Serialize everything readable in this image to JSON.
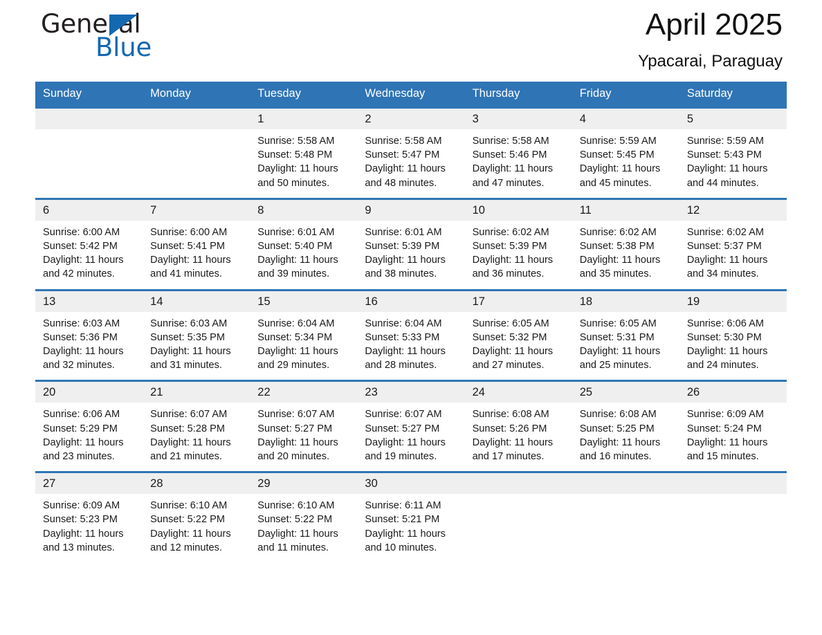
{
  "brand": {
    "word_one": "General",
    "word_two": "Blue",
    "triangle_color": "#1368b0"
  },
  "header": {
    "title": "April 2025",
    "subtitle": "Ypacarai, Paraguay",
    "accent_color": "#2f74b5",
    "daynum_band_color": "#efefef"
  },
  "calendar": {
    "weekdays": [
      "Sunday",
      "Monday",
      "Tuesday",
      "Wednesday",
      "Thursday",
      "Friday",
      "Saturday"
    ],
    "weeks": [
      [
        {
          "day": "",
          "empty": true
        },
        {
          "day": "",
          "empty": true
        },
        {
          "day": "1",
          "sunrise": "Sunrise: 5:58 AM",
          "sunset": "Sunset: 5:48 PM",
          "daylight_1": "Daylight: 11 hours",
          "daylight_2": "and 50 minutes."
        },
        {
          "day": "2",
          "sunrise": "Sunrise: 5:58 AM",
          "sunset": "Sunset: 5:47 PM",
          "daylight_1": "Daylight: 11 hours",
          "daylight_2": "and 48 minutes."
        },
        {
          "day": "3",
          "sunrise": "Sunrise: 5:58 AM",
          "sunset": "Sunset: 5:46 PM",
          "daylight_1": "Daylight: 11 hours",
          "daylight_2": "and 47 minutes."
        },
        {
          "day": "4",
          "sunrise": "Sunrise: 5:59 AM",
          "sunset": "Sunset: 5:45 PM",
          "daylight_1": "Daylight: 11 hours",
          "daylight_2": "and 45 minutes."
        },
        {
          "day": "5",
          "sunrise": "Sunrise: 5:59 AM",
          "sunset": "Sunset: 5:43 PM",
          "daylight_1": "Daylight: 11 hours",
          "daylight_2": "and 44 minutes."
        }
      ],
      [
        {
          "day": "6",
          "sunrise": "Sunrise: 6:00 AM",
          "sunset": "Sunset: 5:42 PM",
          "daylight_1": "Daylight: 11 hours",
          "daylight_2": "and 42 minutes."
        },
        {
          "day": "7",
          "sunrise": "Sunrise: 6:00 AM",
          "sunset": "Sunset: 5:41 PM",
          "daylight_1": "Daylight: 11 hours",
          "daylight_2": "and 41 minutes."
        },
        {
          "day": "8",
          "sunrise": "Sunrise: 6:01 AM",
          "sunset": "Sunset: 5:40 PM",
          "daylight_1": "Daylight: 11 hours",
          "daylight_2": "and 39 minutes."
        },
        {
          "day": "9",
          "sunrise": "Sunrise: 6:01 AM",
          "sunset": "Sunset: 5:39 PM",
          "daylight_1": "Daylight: 11 hours",
          "daylight_2": "and 38 minutes."
        },
        {
          "day": "10",
          "sunrise": "Sunrise: 6:02 AM",
          "sunset": "Sunset: 5:39 PM",
          "daylight_1": "Daylight: 11 hours",
          "daylight_2": "and 36 minutes."
        },
        {
          "day": "11",
          "sunrise": "Sunrise: 6:02 AM",
          "sunset": "Sunset: 5:38 PM",
          "daylight_1": "Daylight: 11 hours",
          "daylight_2": "and 35 minutes."
        },
        {
          "day": "12",
          "sunrise": "Sunrise: 6:02 AM",
          "sunset": "Sunset: 5:37 PM",
          "daylight_1": "Daylight: 11 hours",
          "daylight_2": "and 34 minutes."
        }
      ],
      [
        {
          "day": "13",
          "sunrise": "Sunrise: 6:03 AM",
          "sunset": "Sunset: 5:36 PM",
          "daylight_1": "Daylight: 11 hours",
          "daylight_2": "and 32 minutes."
        },
        {
          "day": "14",
          "sunrise": "Sunrise: 6:03 AM",
          "sunset": "Sunset: 5:35 PM",
          "daylight_1": "Daylight: 11 hours",
          "daylight_2": "and 31 minutes."
        },
        {
          "day": "15",
          "sunrise": "Sunrise: 6:04 AM",
          "sunset": "Sunset: 5:34 PM",
          "daylight_1": "Daylight: 11 hours",
          "daylight_2": "and 29 minutes."
        },
        {
          "day": "16",
          "sunrise": "Sunrise: 6:04 AM",
          "sunset": "Sunset: 5:33 PM",
          "daylight_1": "Daylight: 11 hours",
          "daylight_2": "and 28 minutes."
        },
        {
          "day": "17",
          "sunrise": "Sunrise: 6:05 AM",
          "sunset": "Sunset: 5:32 PM",
          "daylight_1": "Daylight: 11 hours",
          "daylight_2": "and 27 minutes."
        },
        {
          "day": "18",
          "sunrise": "Sunrise: 6:05 AM",
          "sunset": "Sunset: 5:31 PM",
          "daylight_1": "Daylight: 11 hours",
          "daylight_2": "and 25 minutes."
        },
        {
          "day": "19",
          "sunrise": "Sunrise: 6:06 AM",
          "sunset": "Sunset: 5:30 PM",
          "daylight_1": "Daylight: 11 hours",
          "daylight_2": "and 24 minutes."
        }
      ],
      [
        {
          "day": "20",
          "sunrise": "Sunrise: 6:06 AM",
          "sunset": "Sunset: 5:29 PM",
          "daylight_1": "Daylight: 11 hours",
          "daylight_2": "and 23 minutes."
        },
        {
          "day": "21",
          "sunrise": "Sunrise: 6:07 AM",
          "sunset": "Sunset: 5:28 PM",
          "daylight_1": "Daylight: 11 hours",
          "daylight_2": "and 21 minutes."
        },
        {
          "day": "22",
          "sunrise": "Sunrise: 6:07 AM",
          "sunset": "Sunset: 5:27 PM",
          "daylight_1": "Daylight: 11 hours",
          "daylight_2": "and 20 minutes."
        },
        {
          "day": "23",
          "sunrise": "Sunrise: 6:07 AM",
          "sunset": "Sunset: 5:27 PM",
          "daylight_1": "Daylight: 11 hours",
          "daylight_2": "and 19 minutes."
        },
        {
          "day": "24",
          "sunrise": "Sunrise: 6:08 AM",
          "sunset": "Sunset: 5:26 PM",
          "daylight_1": "Daylight: 11 hours",
          "daylight_2": "and 17 minutes."
        },
        {
          "day": "25",
          "sunrise": "Sunrise: 6:08 AM",
          "sunset": "Sunset: 5:25 PM",
          "daylight_1": "Daylight: 11 hours",
          "daylight_2": "and 16 minutes."
        },
        {
          "day": "26",
          "sunrise": "Sunrise: 6:09 AM",
          "sunset": "Sunset: 5:24 PM",
          "daylight_1": "Daylight: 11 hours",
          "daylight_2": "and 15 minutes."
        }
      ],
      [
        {
          "day": "27",
          "sunrise": "Sunrise: 6:09 AM",
          "sunset": "Sunset: 5:23 PM",
          "daylight_1": "Daylight: 11 hours",
          "daylight_2": "and 13 minutes."
        },
        {
          "day": "28",
          "sunrise": "Sunrise: 6:10 AM",
          "sunset": "Sunset: 5:22 PM",
          "daylight_1": "Daylight: 11 hours",
          "daylight_2": "and 12 minutes."
        },
        {
          "day": "29",
          "sunrise": "Sunrise: 6:10 AM",
          "sunset": "Sunset: 5:22 PM",
          "daylight_1": "Daylight: 11 hours",
          "daylight_2": "and 11 minutes."
        },
        {
          "day": "30",
          "sunrise": "Sunrise: 6:11 AM",
          "sunset": "Sunset: 5:21 PM",
          "daylight_1": "Daylight: 11 hours",
          "daylight_2": "and 10 minutes."
        },
        {
          "day": "",
          "empty": true
        },
        {
          "day": "",
          "empty": true
        },
        {
          "day": "",
          "empty": true
        }
      ]
    ]
  }
}
